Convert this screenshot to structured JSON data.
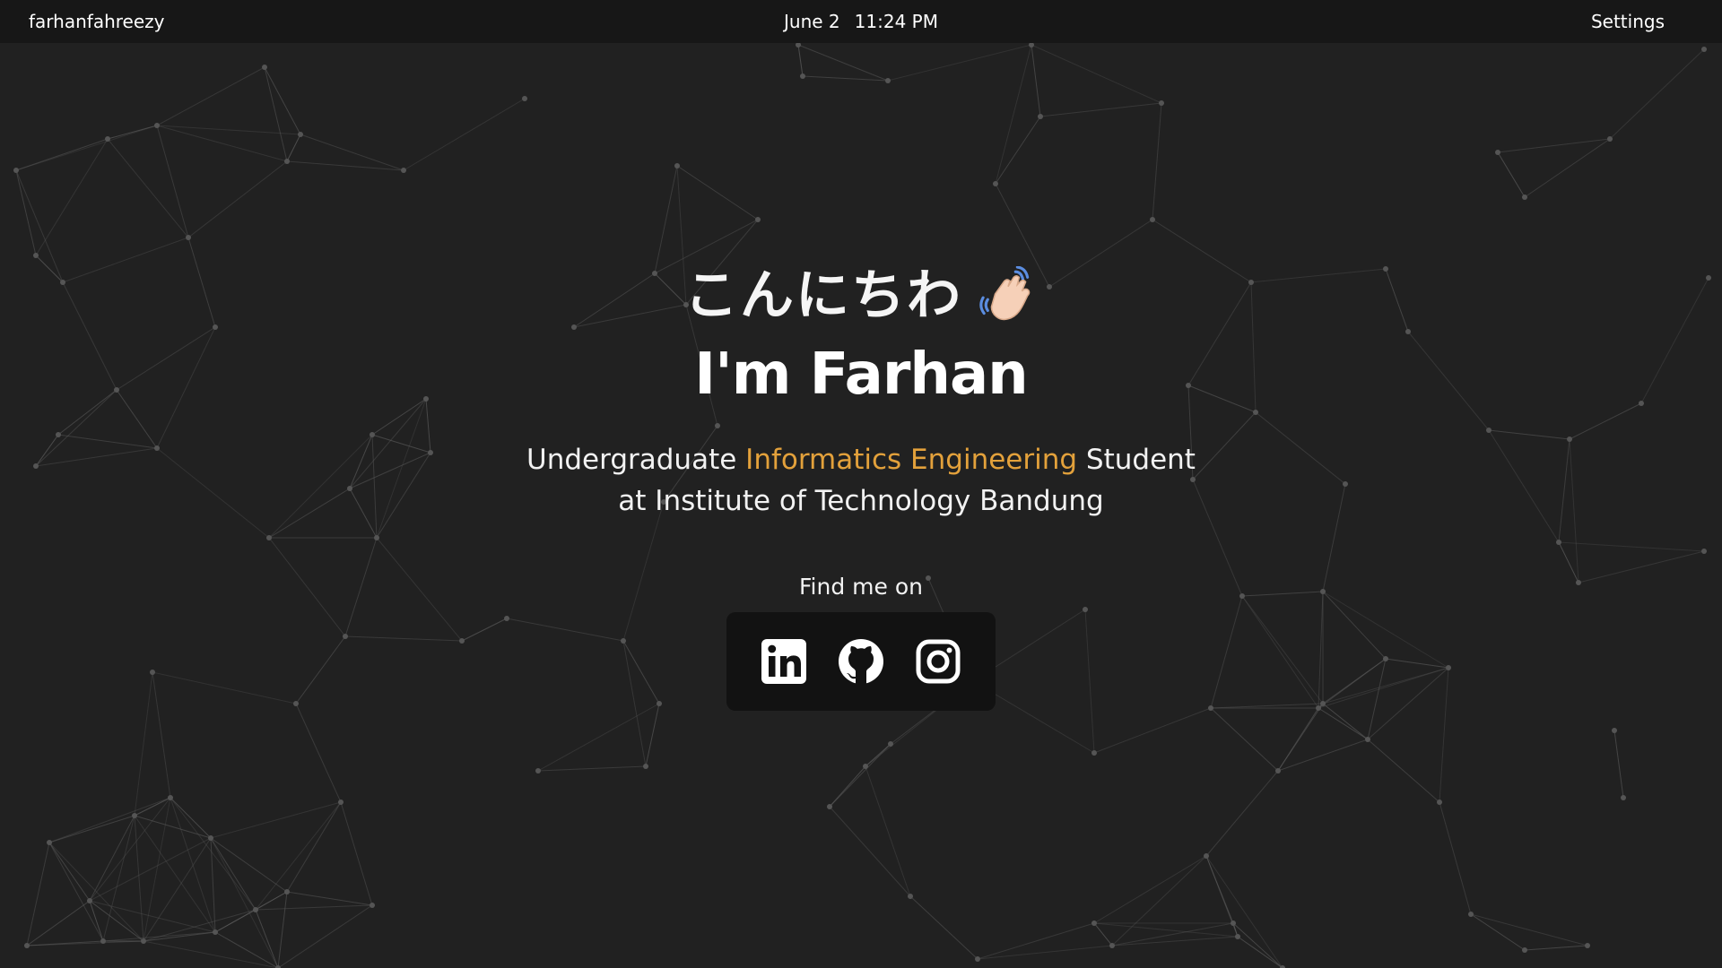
{
  "topbar": {
    "brand": "farhanfahreezy",
    "date": "June 2",
    "time": "11:24 PM",
    "settings": "Settings"
  },
  "hero": {
    "greeting": "こんにちわ",
    "wave_icon": "waving-hand-emoji",
    "name": "I'm Farhan",
    "subtitle_pre": "Undergraduate ",
    "subtitle_accent": "Informatics Engineering",
    "subtitle_post": " Student at Institute of Technology Bandung",
    "find_me": "Find me on"
  },
  "socials": [
    {
      "name": "linkedin-icon"
    },
    {
      "name": "github-icon"
    },
    {
      "name": "instagram-icon"
    }
  ],
  "colors": {
    "background": "#212121",
    "topbar": "#171717",
    "accent": "#e3a13b",
    "social_panel": "#121212",
    "network_lines": "#5a5a5a"
  }
}
